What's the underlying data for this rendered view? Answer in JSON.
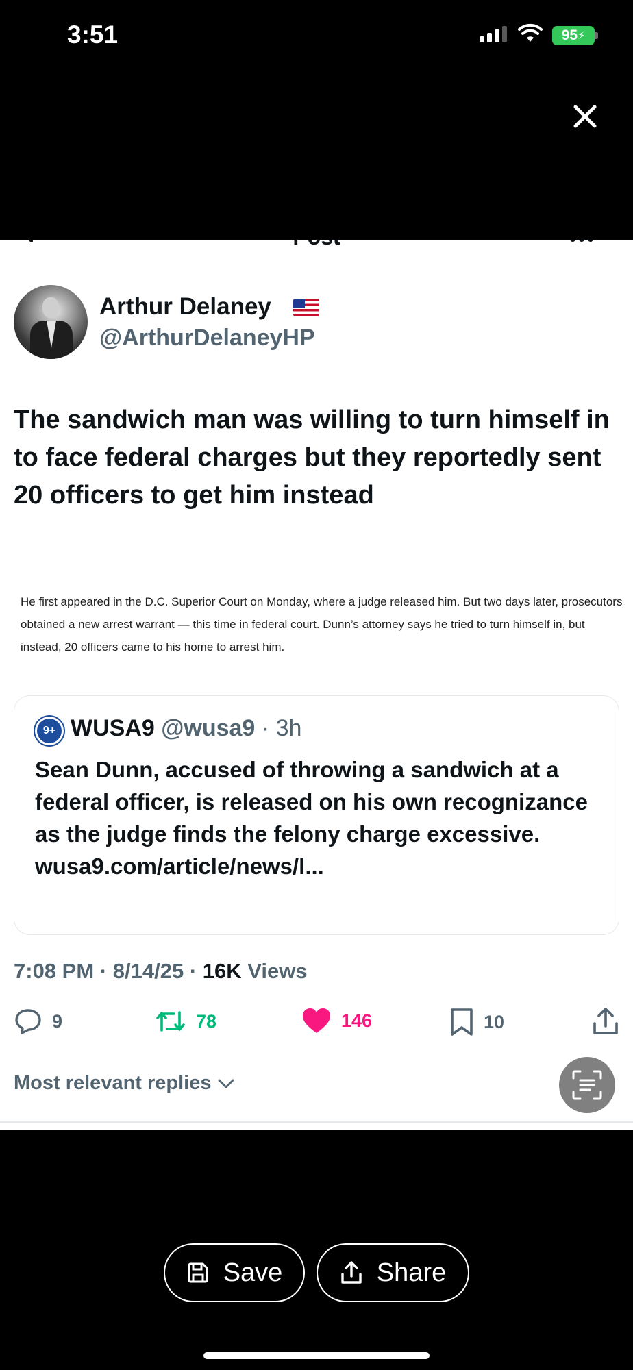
{
  "status_bar": {
    "time": "3:51",
    "battery": "95"
  },
  "post_nav": {
    "title": "Post"
  },
  "author": {
    "name": "Arthur Delaney",
    "handle": "@ArthurDelaneyHP"
  },
  "post": {
    "text": "The sandwich man was willing to turn himself in to face federal charges but they reportedly sent 20 officers to get him instead",
    "excerpt": "He first appeared in the D.C. Superior Court on Monday, where a judge released him. But two days later, prosecutors obtained a new arrest warrant — this time in federal court. Dunn’s attorney says he tried to turn himself in, but instead, 20 officers came to his home to arrest him."
  },
  "quoted_post": {
    "logo_text": "9+",
    "name": "WUSA9",
    "handle": "@wusa9",
    "time": "· 3h",
    "text": "Sean Dunn, accused of throwing a sandwich at a federal officer, is released on his own recognizance as the judge finds the felony charge excessive. wusa9.com/article/news/l..."
  },
  "meta": {
    "time": "7:08 PM",
    "date": "8/14/25",
    "sep": "·",
    "views_count": "16K",
    "views_label": "Views"
  },
  "actions": {
    "replies": "9",
    "reposts": "78",
    "likes": "146",
    "bookmarks": "10"
  },
  "replies_sort": {
    "label": "Most relevant replies"
  },
  "sheet": {
    "save_label": "Save",
    "share_label": "Share"
  },
  "colors": {
    "repost": "#00ba7c",
    "like": "#f91880",
    "muted": "#536471",
    "battery": "#34c759"
  },
  "icons": [
    "signal-icon",
    "wifi-icon",
    "close-icon",
    "back-arrow-icon",
    "more-icon",
    "us-flag-icon",
    "reply-icon",
    "repost-icon",
    "heart-icon",
    "bookmark-icon",
    "share-icon",
    "chevron-down-icon",
    "grok-icon",
    "save-icon",
    "share-upload-icon"
  ]
}
